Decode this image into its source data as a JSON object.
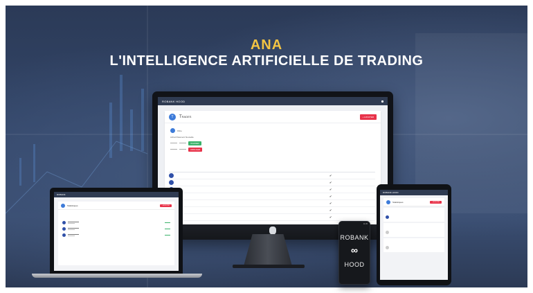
{
  "headline": {
    "line1": "ANA",
    "line2": "L'INTELLIGENCE ARTIFICIELLE DE TRADING"
  },
  "colors": {
    "accent_yellow": "#f3c443",
    "background_navy": "#2f3f5f",
    "app_bar": "#2f3b52",
    "button_red": "#e8334a",
    "button_green": "#3ab26a",
    "badge_blue": "#3d7bd9"
  },
  "monitor": {
    "brand": "ROBANK HOOD",
    "card_title": "Trades",
    "header_button": "+ AJOUTER",
    "badge_letter": "T",
    "filter_label": "Filtre",
    "filter_sublabels": "Achat  Paiement  Nouvelle",
    "green_button": "VALIDER",
    "red_button": "ANNULER",
    "logo_icon": "apple-logo-icon"
  },
  "laptop": {
    "brand": "ROBANK",
    "card_title": "Statistiques",
    "header_button": "+ AJOUTER"
  },
  "tablet": {
    "brand": "ROBANK HOOD",
    "card_title": "Statistiques",
    "header_button": "+ AJOUTER"
  },
  "phone": {
    "status_time": "11:05",
    "word1": "ROBANK",
    "loop_symbol": "∞",
    "word2": "HOOD"
  }
}
